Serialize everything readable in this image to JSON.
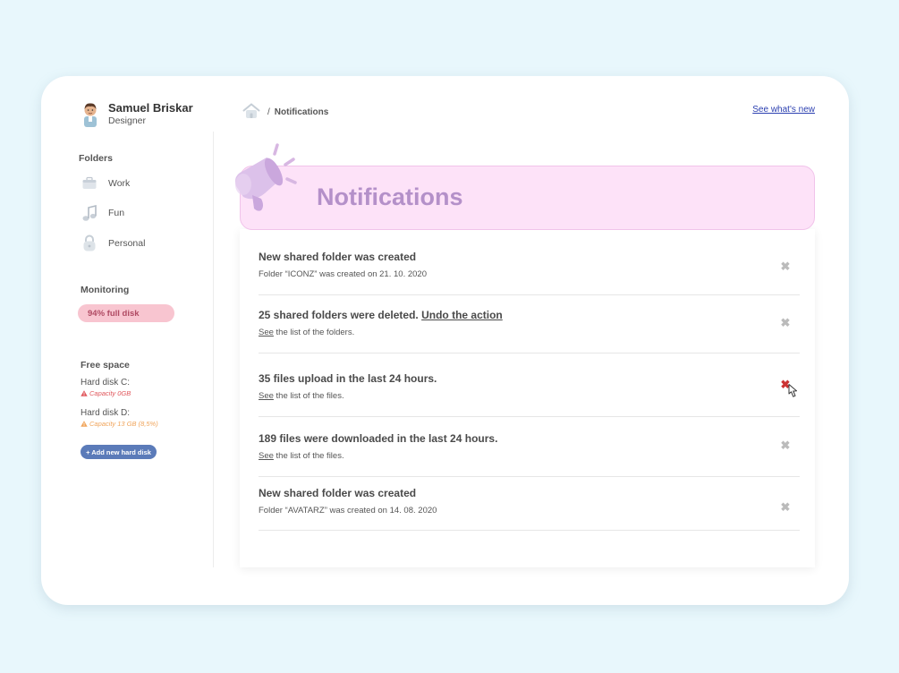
{
  "user": {
    "name": "Samuel Briskar",
    "role": "Designer"
  },
  "sidebar": {
    "folders_title": "Folders",
    "folders": [
      {
        "label": "Work",
        "icon": "briefcase-icon"
      },
      {
        "label": "Fun",
        "icon": "music-note-icon"
      },
      {
        "label": "Personal",
        "icon": "lock-icon"
      }
    ],
    "monitoring_title": "Monitoring",
    "monitoring_badge": "94% full disk",
    "free_space_title": "Free space",
    "disks": [
      {
        "name": "Hard disk C:",
        "capacity": "Capacity 0GB",
        "color": "#e0565b"
      },
      {
        "name": "Hard disk D:",
        "capacity": "Capacity 13 GB (8,5%)",
        "color": "#f0a45a"
      }
    ],
    "add_disk_label": "+ Add new hard disk"
  },
  "header": {
    "breadcrumb_separator": "/",
    "breadcrumb_current": "Notifications",
    "whats_new_link": "See what's new"
  },
  "banner": {
    "title": "Notifications"
  },
  "notifications": [
    {
      "title": "New shared folder was created",
      "title_link": "",
      "desc_link": "",
      "desc": "Folder “ICONZ” was created on 21. 10. 2020"
    },
    {
      "title": "25 shared folders were deleted.",
      "title_link": "Undo the action",
      "desc_link": "See",
      "desc": " the list of the folders."
    },
    {
      "title": "35 files upload in the last 24 hours.",
      "title_link": "",
      "desc_link": "See",
      "desc": " the list of the files."
    },
    {
      "title": "189 files were downloaded in the last 24 hours.",
      "title_link": "",
      "desc_link": "See",
      "desc": " the list of the files."
    },
    {
      "title": "New shared folder was created",
      "title_link": "",
      "desc_link": "",
      "desc": "Folder “AVATARZ” was created on 14. 08. 2020"
    }
  ],
  "colors": {
    "background": "#e8f7fc",
    "banner_bg": "#fde2f8",
    "banner_text": "#b490c9",
    "alert_badge_bg": "#f8c5d0",
    "add_button_bg": "#5b7bb9",
    "link": "#2b3fb0",
    "close_active": "#cc3333"
  }
}
